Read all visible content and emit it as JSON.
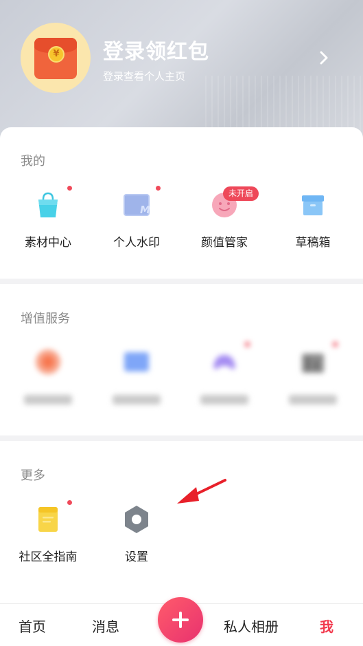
{
  "header": {
    "title": "登录领红包",
    "subtitle": "登录查看个人主页",
    "coin_symbol": "¥"
  },
  "mine": {
    "title": "我的",
    "items": [
      {
        "label": "素材中心",
        "icon": "shopping-bag-icon",
        "dot": true
      },
      {
        "label": "个人水印",
        "icon": "watermark-icon",
        "dot": true
      },
      {
        "label": "颜值管家",
        "icon": "face-icon",
        "badge": "未开启"
      },
      {
        "label": "草稿箱",
        "icon": "archive-box-icon"
      }
    ]
  },
  "value_services": {
    "title": "增值服务"
  },
  "more": {
    "title": "更多",
    "items": [
      {
        "label": "社区全指南",
        "icon": "notebook-icon",
        "dot": true
      },
      {
        "label": "设置",
        "icon": "gear-icon"
      }
    ]
  },
  "tabbar": {
    "home": "首页",
    "messages": "消息",
    "album": "私人相册",
    "me": "我"
  },
  "colors": {
    "accent": "#f23a4e",
    "badge": "#ee4859",
    "annotation_arrow": "#e8202a"
  }
}
